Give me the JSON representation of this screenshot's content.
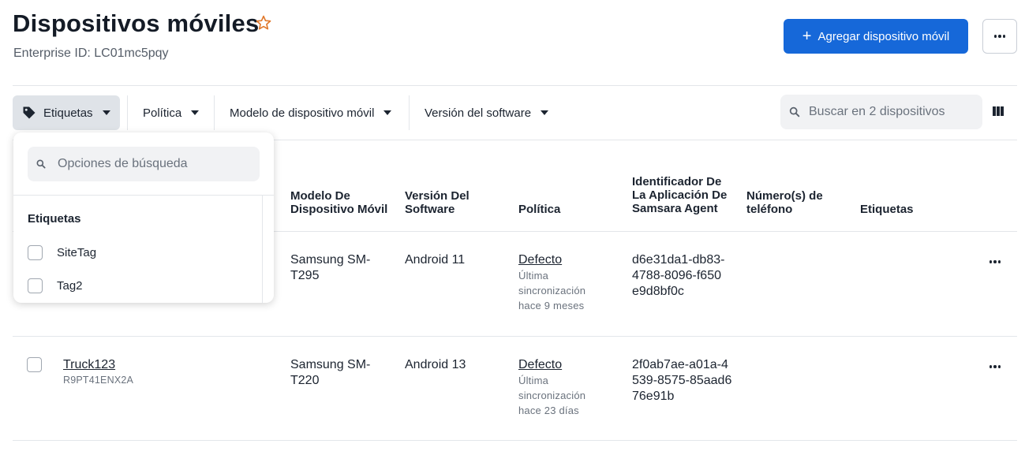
{
  "header": {
    "title": "Dispositivos móviles",
    "enterprise_id": "Enterprise ID: LC01mc5pqy",
    "add_button_label": "Agregar dispositivo móvil"
  },
  "filters": [
    {
      "label": "Etiquetas"
    },
    {
      "label": "Política"
    },
    {
      "label": "Modelo de dispositivo móvil"
    },
    {
      "label": "Versión del software"
    }
  ],
  "search": {
    "placeholder": "Buscar en 2 dispositivos"
  },
  "dropdown": {
    "search_placeholder": "Opciones de búsqueda",
    "heading": "Etiquetas",
    "options": [
      "SiteTag",
      "Tag2"
    ]
  },
  "table": {
    "columns": {
      "model": "Modelo De Dispositivo Móvil",
      "software": "Versión Del Software",
      "policy": "Política",
      "agent_id": "Identificador De La Aplicación De Samsara Agent",
      "phone": "Número(s) de teléfono",
      "tags": "Etiquetas"
    },
    "rows": [
      {
        "name": "",
        "serial": "",
        "model": "Samsung SM-T295",
        "software": "Android 11",
        "policy": "Defecto",
        "sync": "Última sincronización hace 9 meses",
        "agent_id": "d6e31da1-db83-4788-8096-f650e9d8bf0c"
      },
      {
        "name": "Truck123",
        "serial": "R9PT41ENX2A",
        "model": "Samsung SM-T220",
        "software": "Android 13",
        "policy": "Defecto",
        "sync": "Última sincronización hace 23 días",
        "agent_id": "2f0ab7ae-a01a-4539-8575-85aad676e91b"
      }
    ]
  },
  "colors": {
    "accent": "#1668d9",
    "star": "#e0782b"
  },
  "icons": [
    "star-icon",
    "plus-icon",
    "more-icon",
    "tag-icon",
    "search-icon",
    "columns-icon"
  ]
}
